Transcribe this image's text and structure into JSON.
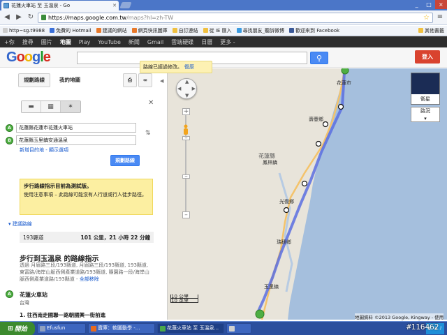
{
  "browser": {
    "tab_title": "花蓮火車站 至 玉溫泉 - Go",
    "url_host": "https://maps.google.com.tw",
    "url_path": "/maps?hl=zh-TW",
    "window_buttons": [
      "_",
      "□",
      "×"
    ],
    "bookmarks": [
      "http~sg.t9988",
      "免費的 Hotmail",
      "建議的網站",
      "網頁快訊圖庫",
      "自訂連結",
      "從 IE 匯入",
      "尋找朋友_聽訴微博",
      "歡迎來到 Facebook"
    ],
    "other_bookmarks": "其他書籤"
  },
  "gbar": {
    "items": [
      "+你",
      "搜尋",
      "圖片",
      "地圖",
      "Play",
      "YouTube",
      "新聞",
      "Gmail",
      "雲端硬碟",
      "日曆",
      "更多 -"
    ],
    "active": "地圖"
  },
  "header": {
    "logo": "Google",
    "logo_colors": [
      "#3366cc",
      "#d62d20",
      "#f0b400",
      "#3366cc",
      "#1a9a2a",
      "#d62d20"
    ],
    "signin_label": "登入"
  },
  "panel": {
    "tab_directions": "規劃路線",
    "tab_mymaps": "我的地圖",
    "modes": [
      "car-icon",
      "bus-icon",
      "walk-icon"
    ],
    "waypoint_a": "花蓮縣花蓮市花蓮火車站",
    "waypoint_b": "花蓮縣玉里鎮安通溫泉",
    "marker_a": "A",
    "marker_b": "B",
    "add_destination": "新增目的地 - 顯示選項",
    "get_directions": "規劃路線",
    "warning_title": "步行路線指示目前為測試版。",
    "warning_body": "使用注意事項 – 此路線可能沒有人行道或行人徒步路徑。",
    "alternate_routes": "建議路線",
    "route_name": "193縣道",
    "route_stats": "101 公里，21 小時 22 分鐘",
    "route_heading": "步行到玉溫泉 的路線指示",
    "route_desc": "透過 月眉路三段/193縣道, 月眉路三段/193縣道, 193縣道, 東富路/海岸山脈西側產業道路/193縣道, 隨園路一段/海岸山脈西側產業道路/193縣道 -",
    "route_desc_link": "全部移除",
    "start_name": "花蓮火車站",
    "start_region": "台灣",
    "step1": "1. 往西南走國聯一路朝國興一街前進"
  },
  "map": {
    "notice": "路線已經過修改。",
    "notice_undo": "復原",
    "satellite_label": "衛星",
    "traffic_label": "路況",
    "place_labels": [
      "花蓮市",
      "壽豐鄉",
      "花蓮縣",
      "鳳林鎮",
      "光復鄉",
      "瑞穗鄉",
      "玉里鎮"
    ],
    "scale_km": "10 公里",
    "scale_mi": "10 英里",
    "attribution": "地圖資料 ©2013 Google, Kingway - 使用",
    "colors": {
      "sea": "#a5bfdd",
      "land": "#e8e4da",
      "route": "#5a6ee0"
    }
  },
  "taskbar": {
    "start_label": "開始",
    "tasks": [
      "Efusfun",
      "寶庫：軟圖動學 -...",
      "花蓮火車站 至 玉溫泉...",
      ""
    ],
    "active_index": 2,
    "counter": "#116462"
  }
}
